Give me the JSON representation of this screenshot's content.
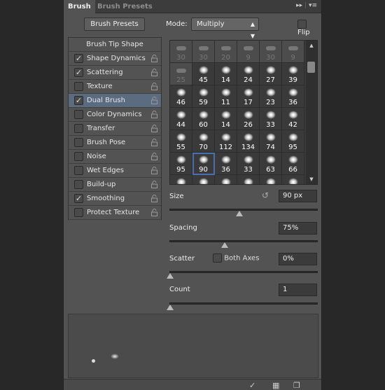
{
  "tabs": [
    {
      "label": "Brush",
      "active": true
    },
    {
      "label": "Brush Presets",
      "active": false
    }
  ],
  "toolbar": {
    "brush_presets_label": "Brush Presets",
    "mode_label": "Mode:",
    "mode_value": "Multiply",
    "flip_label": "Flip",
    "flip_checked": false
  },
  "settings": [
    {
      "label": "Brush Tip Shape",
      "header": true
    },
    {
      "label": "Shape Dynamics",
      "checked": true
    },
    {
      "label": "Scattering",
      "checked": true
    },
    {
      "label": "Texture",
      "checked": false
    },
    {
      "label": "Dual Brush",
      "checked": true,
      "selected": true
    },
    {
      "label": "Color Dynamics",
      "checked": false
    },
    {
      "label": "Transfer",
      "checked": false
    },
    {
      "label": "Brush Pose",
      "checked": false
    },
    {
      "label": "Noise",
      "checked": false
    },
    {
      "label": "Wet Edges",
      "checked": false
    },
    {
      "label": "Build-up",
      "checked": false
    },
    {
      "label": "Smoothing",
      "checked": true
    },
    {
      "label": "Protect Texture",
      "checked": false
    }
  ],
  "brushes": [
    "30",
    "30",
    "20",
    "9",
    "30",
    "9",
    "25",
    "45",
    "14",
    "24",
    "27",
    "39",
    "46",
    "59",
    "11",
    "17",
    "23",
    "36",
    "44",
    "60",
    "14",
    "26",
    "33",
    "42",
    "55",
    "70",
    "112",
    "134",
    "74",
    "95",
    "95",
    "90",
    "36",
    "33",
    "63",
    "66",
    "",
    "",
    "",
    "",
    "",
    ""
  ],
  "selected_brush": 31,
  "size": {
    "label": "Size",
    "value": "90 px",
    "fraction": 0.47
  },
  "spacing": {
    "label": "Spacing",
    "value": "75%",
    "fraction": 0.37
  },
  "scatter": {
    "label": "Scatter",
    "both_axes_label": "Both Axes",
    "both_axes_checked": false,
    "value": "0%",
    "fraction": 0
  },
  "count": {
    "label": "Count",
    "value": "1",
    "fraction": 0
  },
  "colors": {
    "panel": "#535353",
    "selection": "#5b6c80",
    "selected_brush_outline": "#4a6fb0"
  }
}
